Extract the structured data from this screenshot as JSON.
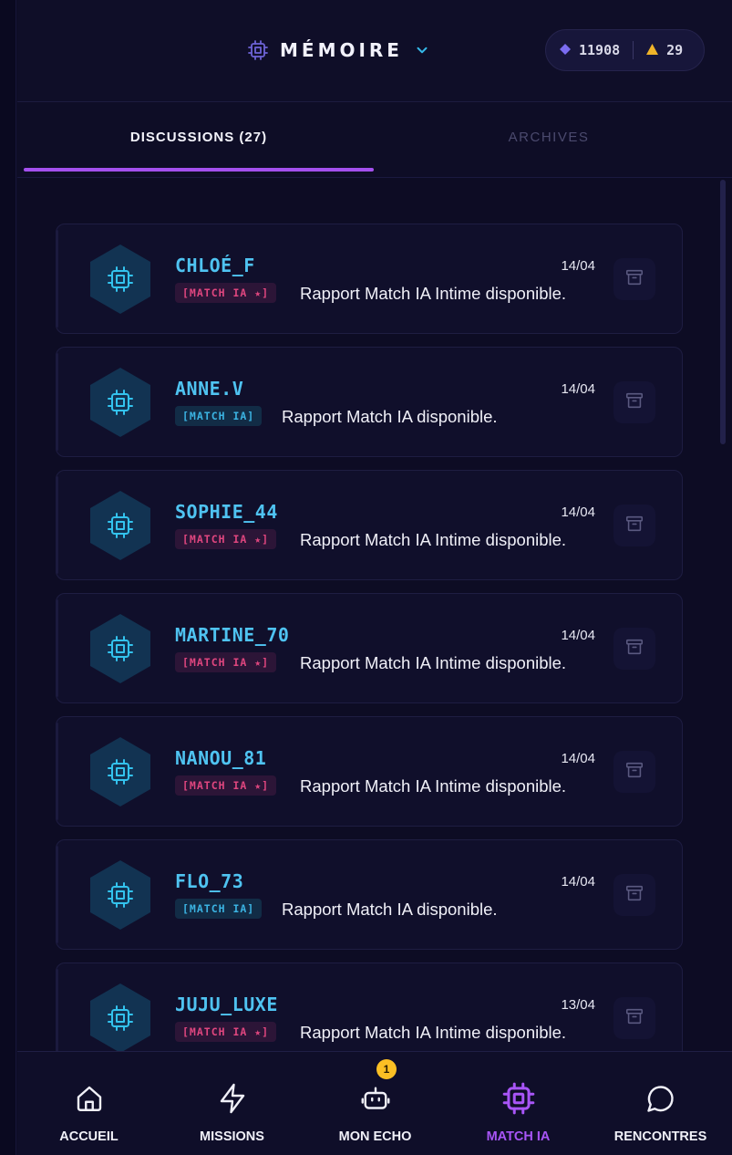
{
  "header": {
    "title": "MÉMOIRE",
    "title_icon": "cpu-chip-icon",
    "dropdown_icon": "chevron-down-icon",
    "wallet": {
      "gems": "11908",
      "gem_icon": "diamond-icon",
      "gem_color": "#7b6cf0",
      "alerts": "29",
      "alert_icon": "triangle-icon",
      "alert_color": "#f0b429"
    }
  },
  "tabs": [
    {
      "label": "DISCUSSIONS (27)",
      "active": true
    },
    {
      "label": "ARCHIVES",
      "active": false
    }
  ],
  "conversations": [
    {
      "name": "CHLOÉ_F",
      "date": "14/04",
      "tag": "[MATCH IA ★]",
      "tag_type": "intime",
      "preview": "Rapport Match IA Intime disponible."
    },
    {
      "name": "ANNE.V",
      "date": "14/04",
      "tag": "[MATCH IA]",
      "tag_type": "plain",
      "preview": "Rapport Match IA disponible."
    },
    {
      "name": "SOPHIE_44",
      "date": "14/04",
      "tag": "[MATCH IA ★]",
      "tag_type": "intime",
      "preview": "Rapport Match IA Intime disponible."
    },
    {
      "name": "MARTINE_70",
      "date": "14/04",
      "tag": "[MATCH IA ★]",
      "tag_type": "intime",
      "preview": "Rapport Match IA Intime disponible."
    },
    {
      "name": "NANOU_81",
      "date": "14/04",
      "tag": "[MATCH IA ★]",
      "tag_type": "intime",
      "preview": "Rapport Match IA Intime disponible."
    },
    {
      "name": "FLO_73",
      "date": "14/04",
      "tag": "[MATCH IA]",
      "tag_type": "plain",
      "preview": "Rapport Match IA disponible."
    },
    {
      "name": "JUJU_LUXE",
      "date": "13/04",
      "tag": "[MATCH IA ★]",
      "tag_type": "intime",
      "preview": "Rapport Match IA Intime disponible."
    }
  ],
  "colors": {
    "accent": "#a855f7",
    "name": "#4fc3f1",
    "tag_intime": "#e0467f",
    "tag_plain": "#3bb3e2",
    "badge": "#fbbf24"
  },
  "bottom_nav": [
    {
      "label": "ACCUEIL",
      "icon": "home-icon",
      "active": false
    },
    {
      "label": "MISSIONS",
      "icon": "lightning-icon",
      "active": false
    },
    {
      "label": "MON ECHO",
      "icon": "robot-icon",
      "active": false,
      "badge": "1"
    },
    {
      "label": "MATCH IA",
      "icon": "cpu-chip-icon",
      "active": true
    },
    {
      "label": "RENCONTRES",
      "icon": "chat-bubble-icon",
      "active": false
    }
  ]
}
